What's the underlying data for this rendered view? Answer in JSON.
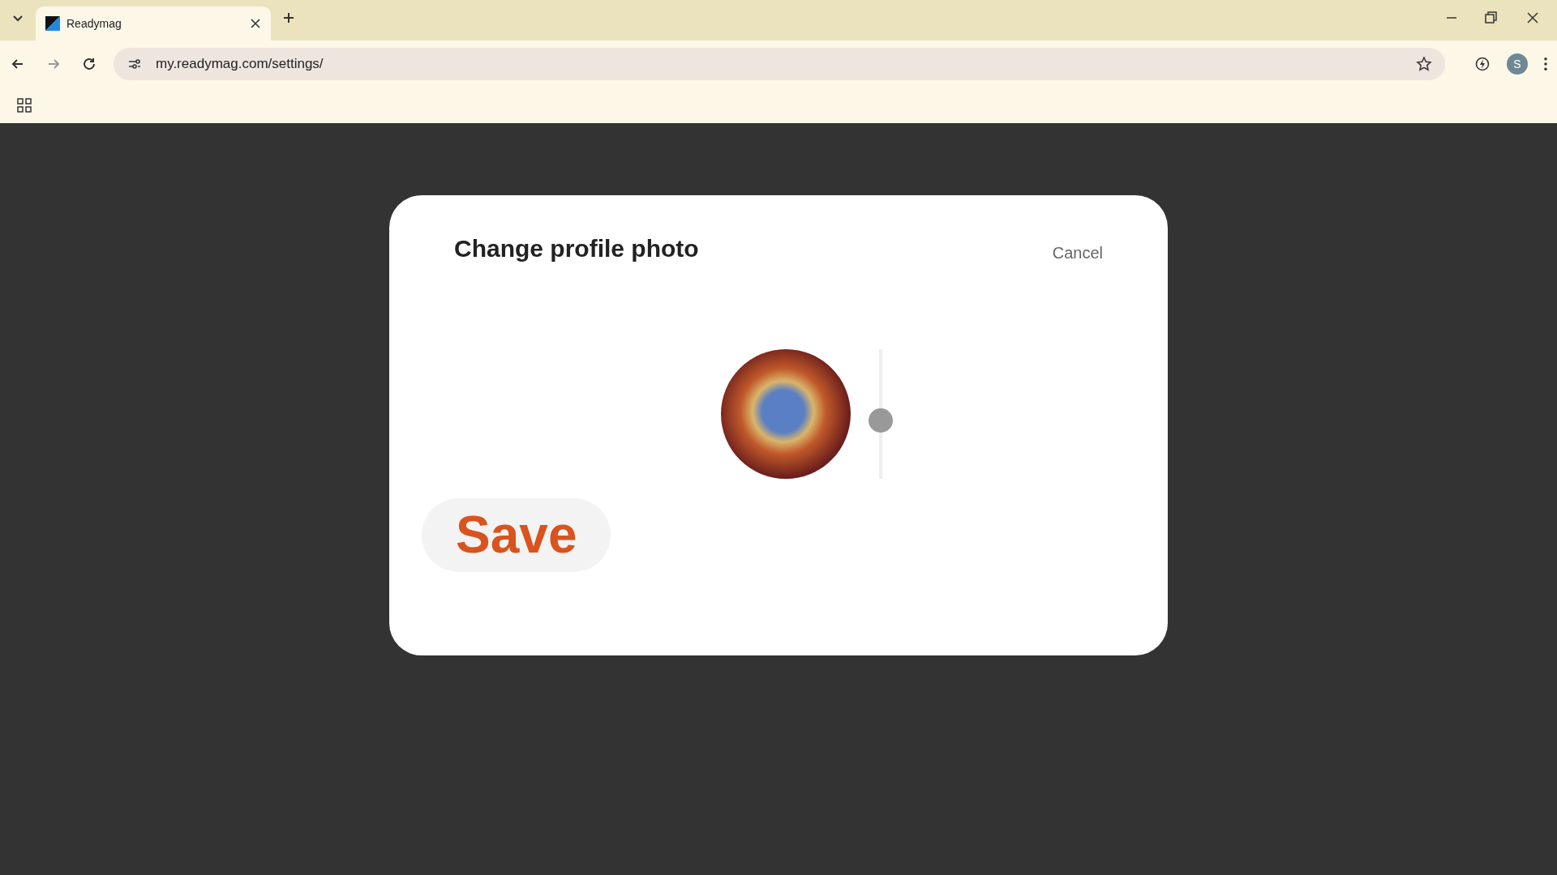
{
  "browser": {
    "tabs": [
      {
        "title": "Readymag",
        "selected": true
      }
    ],
    "url": "my.readymag.com/settings/",
    "profile_initial": "S"
  },
  "dialog": {
    "title": "Change profile photo",
    "cancel": "Cancel",
    "zoom_slider": {
      "level": 0.44
    },
    "save": "Save"
  }
}
